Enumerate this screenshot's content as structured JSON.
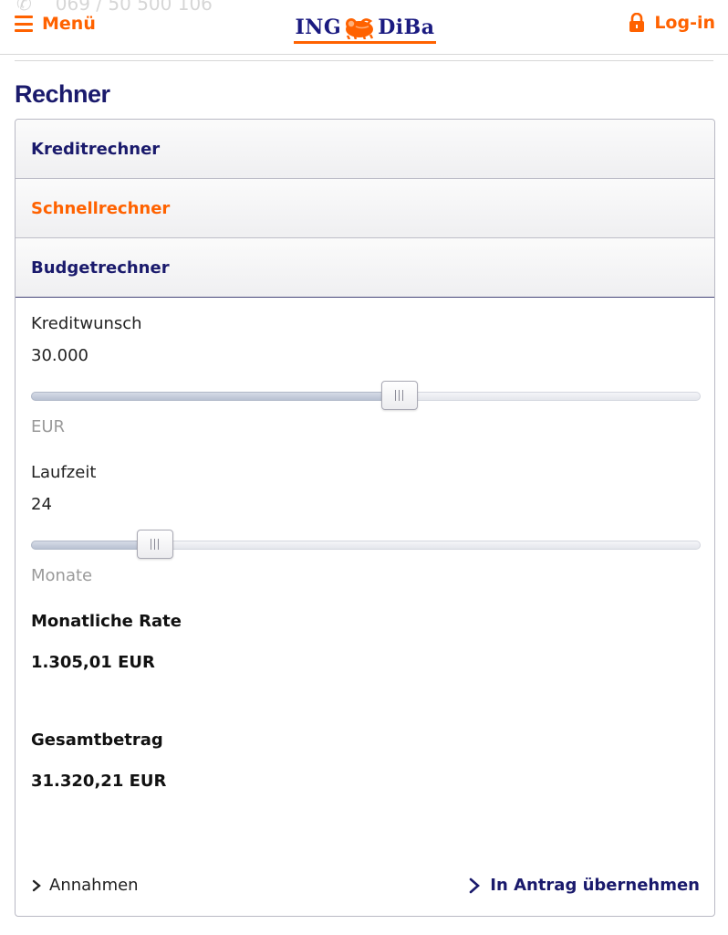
{
  "header": {
    "phone": "069 / 50 500 106",
    "menu_label": "Menü",
    "logo_left": "ING",
    "logo_right": "DiBa",
    "login_label": "Log-in",
    "accent_color": "#ff6200",
    "brand_color": "#1a1a6c"
  },
  "page": {
    "title": "Rechner"
  },
  "accordion": {
    "items": [
      {
        "label": "Kreditrechner"
      },
      {
        "label": "Schnellrechner",
        "state": "active"
      },
      {
        "label": "Budgetrechner"
      }
    ]
  },
  "calculator": {
    "amount": {
      "label": "Kreditwunsch",
      "value": "30.000",
      "unit": "EUR",
      "slider_level": 0.55
    },
    "term": {
      "label": "Laufzeit",
      "value": "24",
      "unit": "Monate",
      "slider_level": 0.185
    },
    "monthly": {
      "label": "Monatliche Rate",
      "value": "1.305,01 EUR"
    },
    "total": {
      "label": "Gesamtbetrag",
      "value": "31.320,21 EUR"
    }
  },
  "footer_links": {
    "assumptions": "Annahmen",
    "apply": "In Antrag übernehmen"
  },
  "icons": [
    "menu-icon",
    "lion-logo-icon",
    "lock-icon",
    "chevron-right-icon"
  ]
}
